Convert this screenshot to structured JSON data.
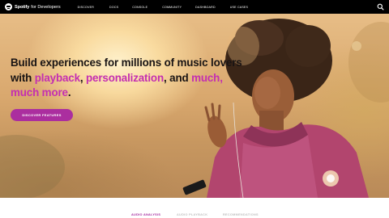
{
  "nav": {
    "brand": "Spotify",
    "brand_suffix": "for Developers",
    "links": [
      "DISCOVER",
      "DOCS",
      "CONSOLE",
      "COMMUNITY",
      "DASHBOARD",
      "USE CASES"
    ],
    "search_icon": "search-icon"
  },
  "hero": {
    "headline_part1": "Build experiences for millions of music lovers with ",
    "highlight1": "playback",
    "sep1": ", ",
    "highlight2": "personalization",
    "sep2": ", and ",
    "highlight3": "much, much more",
    "end": ".",
    "cta_label": "DISCOVER FEATURES",
    "accent_color": "#c42fb1",
    "cta_color": "#ab2e9f"
  },
  "tabs": {
    "items": [
      "AUDIO ANALYSIS",
      "AUDIO PLAYBACK",
      "RECOMMENDATIONS"
    ],
    "active_index": 0
  }
}
